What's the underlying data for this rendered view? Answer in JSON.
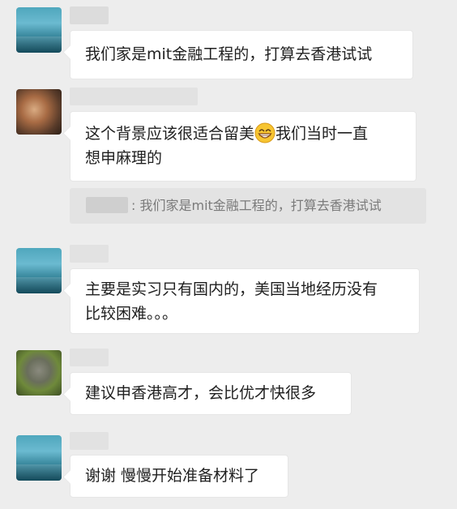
{
  "messages": [
    {
      "lines": [
        "我们家是mit金融工程的，打算去香港试试"
      ]
    },
    {
      "lines_before_emoji": "这个背景应该很适合留美",
      "lines_after_emoji": "我们当时一直",
      "second_line": "想申麻理的",
      "emoji": "grinning-face-icon",
      "quote": {
        "separator": ": ",
        "text": "我们家是mit金融工程的，打算去香港试试"
      }
    },
    {
      "lines": [
        "主要是实习只有国内的，美国当地经历没有",
        "比较困难。。。"
      ]
    },
    {
      "lines": [
        "建议申香港高才，会比优才快很多"
      ]
    },
    {
      "lines": [
        "谢谢 慢慢开始准备材料了"
      ]
    }
  ],
  "colors": {
    "background": "#ededed",
    "bubble": "#ffffff",
    "quote_background": "#e3e3e3",
    "text": "#1f1f1f",
    "quote_text": "#7a7a7a"
  }
}
